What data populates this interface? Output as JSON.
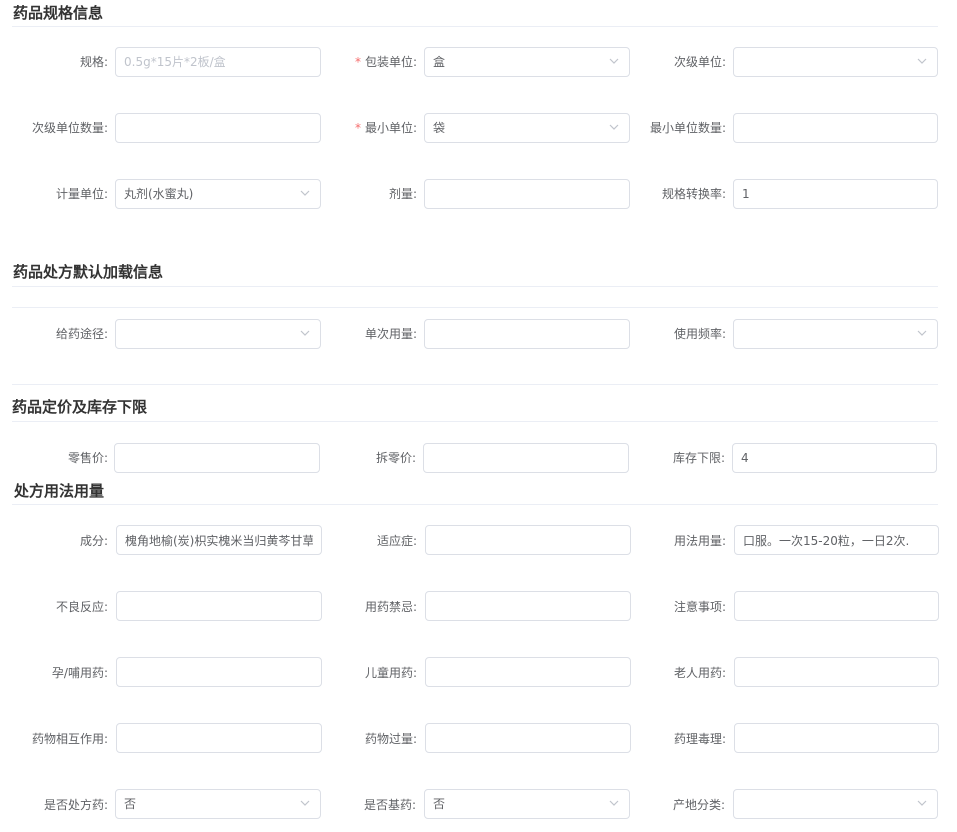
{
  "sections": {
    "spec": "药品规格信息",
    "rx_default": "药品处方默认加载信息",
    "pricing": "药品定价及库存下限",
    "usage": "处方用法用量"
  },
  "spec": {
    "spec_label": "规格:",
    "spec_placeholder": "0.5g*15片*2板/盒",
    "package_unit_label": "包装单位:",
    "package_unit_value": "盒",
    "secondary_unit_label": "次级单位:",
    "secondary_unit_value": "",
    "secondary_qty_label": "次级单位数量:",
    "min_unit_label": "最小单位:",
    "min_unit_value": "袋",
    "min_qty_label": "最小单位数量:",
    "measure_unit_label": "计量单位:",
    "measure_unit_value": "丸剂(水蜜丸)",
    "dose_label": "剂量:",
    "conversion_label": "规格转换率:",
    "conversion_value": "1"
  },
  "rx_default": {
    "route_label": "给药途径:",
    "route_value": "",
    "single_dose_label": "单次用量:",
    "frequency_label": "使用频率:",
    "frequency_value": ""
  },
  "pricing": {
    "retail_label": "零售价:",
    "split_label": "拆零价:",
    "stock_label": "库存下限:",
    "stock_value": "4"
  },
  "usage": {
    "ingredients_label": "成分:",
    "ingredients_value": "槐角地榆(炭)枳实槐米当归黄芩甘草",
    "indication_label": "适应症:",
    "dosage_label": "用法用量:",
    "dosage_value": "口服。一次15-20粒，一日2次.",
    "adverse_label": "不良反应:",
    "contraindication_label": "用药禁忌:",
    "precautions_label": "注意事项:",
    "pregnancy_label": "孕/哺用药:",
    "children_label": "儿童用药:",
    "elderly_label": "老人用药:",
    "interaction_label": "药物相互作用:",
    "overdose_label": "药物过量:",
    "toxicology_label": "药理毒理:",
    "is_rx_label": "是否处方药:",
    "is_rx_value": "否",
    "is_basic_label": "是否基药:",
    "is_basic_value": "否",
    "origin_label": "产地分类:",
    "origin_value": ""
  },
  "icons": {
    "select_arrow": "chevron-down-icon"
  },
  "colors": {
    "required": "#f56c6c",
    "border": "#dcdfe6",
    "title": "#333333"
  }
}
